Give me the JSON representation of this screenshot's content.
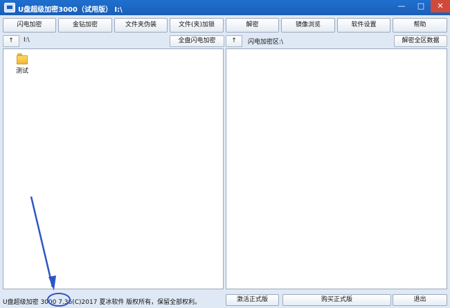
{
  "window": {
    "title": "U盘超级加密3000（试用版） I:\\"
  },
  "toolbar": {
    "buttons": [
      "闪电加密",
      "金钻加密",
      "文件夹伪装",
      "文件(夹)加锁",
      "解密",
      "镜像浏览",
      "软件设置",
      "帮助"
    ]
  },
  "left_pane": {
    "up_label": "↑",
    "path": "I:\\",
    "action_label": "全盘闪电加密",
    "items": [
      {
        "name": "测试",
        "icon": "folder-icon"
      }
    ]
  },
  "right_pane": {
    "up_label": "↑",
    "path": "闪电加密区:\\",
    "action_label": "解密全区数据"
  },
  "statusbar": {
    "copyright": "U盘超级加密 3000 7.36(C)2017 夏冰软件 版权所有，保留全部权利。",
    "activate_label": "激活正式版",
    "buy_label": "购买正式版",
    "exit_label": "退出"
  },
  "colors": {
    "titlebar": "#1a5fb8",
    "annotation": "#2f55c4",
    "close": "#d04a3c"
  }
}
